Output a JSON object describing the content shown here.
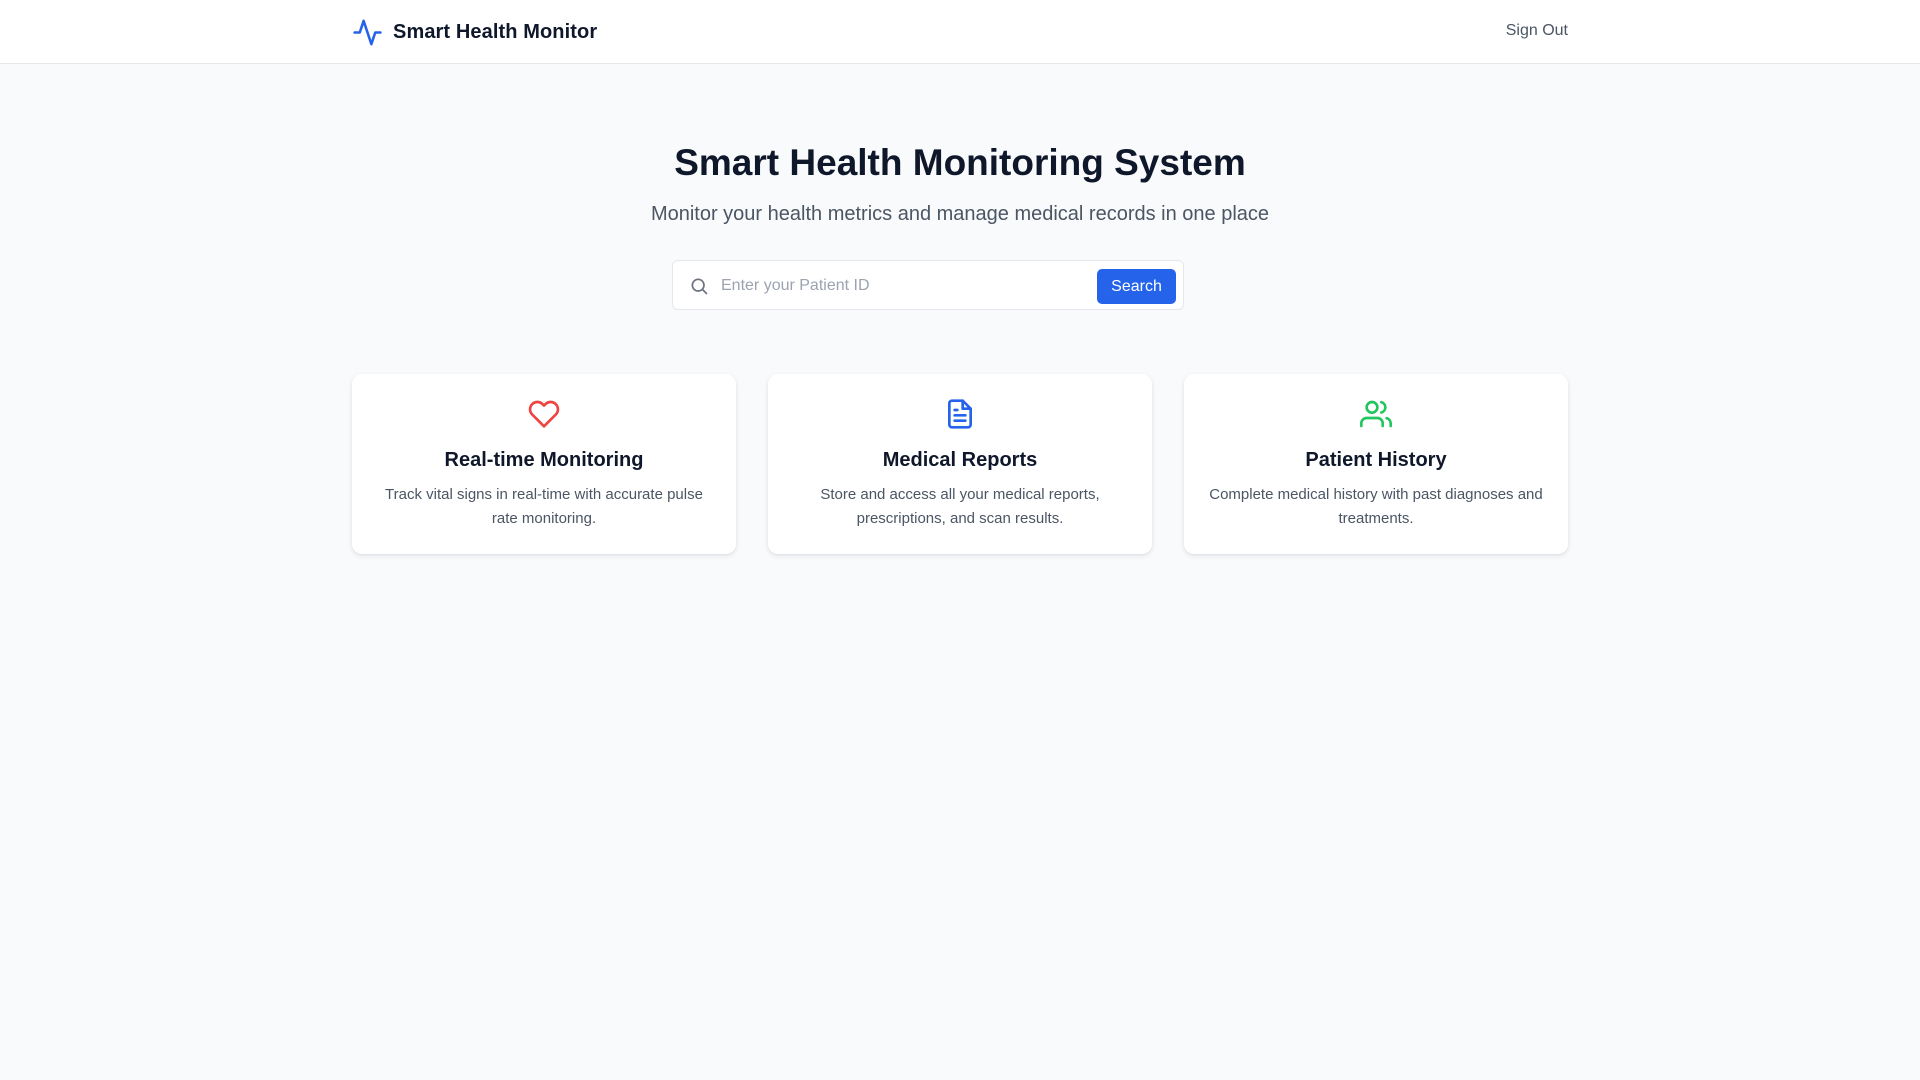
{
  "header": {
    "brand_name": "Smart Health Monitor",
    "sign_out_label": "Sign Out"
  },
  "hero": {
    "title": "Smart Health Monitoring System",
    "subtitle": "Monitor your health metrics and manage medical records in one place"
  },
  "search": {
    "placeholder": "Enter your Patient ID",
    "value": "",
    "button_label": "Search"
  },
  "features": [
    {
      "icon": "heart-icon",
      "icon_color": "#ef4444",
      "title": "Real-time Monitoring",
      "description": "Track vital signs in real-time with accurate pulse rate monitoring."
    },
    {
      "icon": "file-text-icon",
      "icon_color": "#2563eb",
      "title": "Medical Reports",
      "description": "Store and access all your medical reports, prescriptions, and scan results."
    },
    {
      "icon": "users-icon",
      "icon_color": "#22c55e",
      "title": "Patient History",
      "description": "Complete medical history with past diagnoses and treatments."
    }
  ],
  "colors": {
    "accent": "#2563eb",
    "background": "#f8fafc",
    "heart": "#ef4444",
    "users": "#22c55e"
  }
}
